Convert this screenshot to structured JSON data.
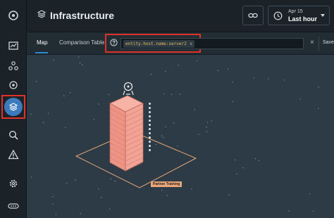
{
  "header": {
    "title": "Infrastructure",
    "time_picker": {
      "date": "Apr 15",
      "range": "Last hour"
    }
  },
  "tabs": [
    {
      "label": "Map",
      "active": true
    },
    {
      "label": "Comparison Table",
      "active": false
    }
  ],
  "filter": {
    "chip": "entity.host.name:server2",
    "chip_remove": "x",
    "clear": "×",
    "save_label": "Save"
  },
  "map": {
    "zone_label": "Partner Training",
    "host_bar_color": "#f2998a",
    "zone_outline_color": "#e8a77a"
  },
  "sidebar": {
    "active_item": "infrastructure",
    "highlight_color": "#e0302a"
  }
}
